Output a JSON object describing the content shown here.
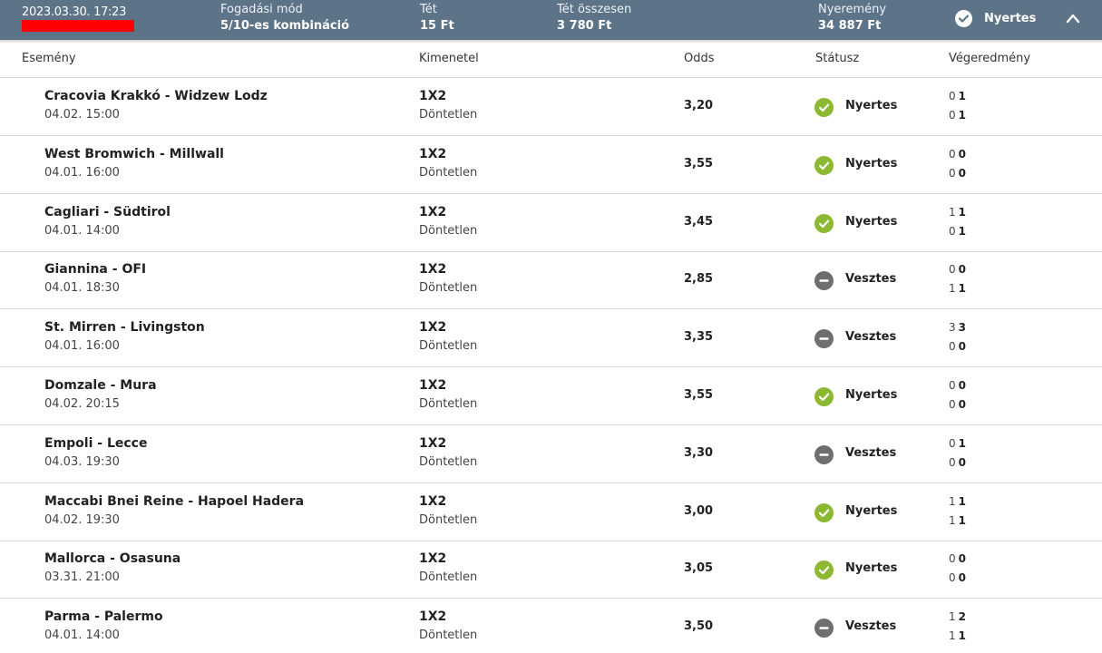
{
  "header": {
    "datetime": "2023.03.30. 17:23",
    "bet_type_label": "Fogadási mód",
    "bet_type_value": "5/10-es kombináció",
    "stake_label": "Tét",
    "stake_value": "15 Ft",
    "total_stake_label": "Tét összesen",
    "total_stake_value": "3 780 Ft",
    "winnings_label": "Nyeremény",
    "winnings_value": "34 887 Ft",
    "status": "Nyertes"
  },
  "columns": {
    "event": "Esemény",
    "outcome": "Kimenetel",
    "odds": "Odds",
    "status": "Státusz",
    "result": "Végeredmény"
  },
  "rows": [
    {
      "event": "Cracovia Krakkó - Widzew Lodz",
      "date": "04.02. 15:00",
      "market": "1X2",
      "outcome": "Döntetlen",
      "odds": "3,20",
      "status": "Nyertes",
      "win": true,
      "ht_home": "0",
      "ft_home": "1",
      "ht_away": "0",
      "ft_away": "1"
    },
    {
      "event": "West Bromwich - Millwall",
      "date": "04.01. 16:00",
      "market": "1X2",
      "outcome": "Döntetlen",
      "odds": "3,55",
      "status": "Nyertes",
      "win": true,
      "ht_home": "0",
      "ft_home": "0",
      "ht_away": "0",
      "ft_away": "0"
    },
    {
      "event": "Cagliari - Südtirol",
      "date": "04.01. 14:00",
      "market": "1X2",
      "outcome": "Döntetlen",
      "odds": "3,45",
      "status": "Nyertes",
      "win": true,
      "ht_home": "1",
      "ft_home": "1",
      "ht_away": "0",
      "ft_away": "1"
    },
    {
      "event": "Giannina - OFI",
      "date": "04.01. 18:30",
      "market": "1X2",
      "outcome": "Döntetlen",
      "odds": "2,85",
      "status": "Vesztes",
      "win": false,
      "ht_home": "0",
      "ft_home": "0",
      "ht_away": "1",
      "ft_away": "1"
    },
    {
      "event": "St. Mirren - Livingston",
      "date": "04.01. 16:00",
      "market": "1X2",
      "outcome": "Döntetlen",
      "odds": "3,35",
      "status": "Vesztes",
      "win": false,
      "ht_home": "3",
      "ft_home": "3",
      "ht_away": "0",
      "ft_away": "0"
    },
    {
      "event": "Domzale - Mura",
      "date": "04.02. 20:15",
      "market": "1X2",
      "outcome": "Döntetlen",
      "odds": "3,55",
      "status": "Nyertes",
      "win": true,
      "ht_home": "0",
      "ft_home": "0",
      "ht_away": "0",
      "ft_away": "0"
    },
    {
      "event": "Empoli - Lecce",
      "date": "04.03. 19:30",
      "market": "1X2",
      "outcome": "Döntetlen",
      "odds": "3,30",
      "status": "Vesztes",
      "win": false,
      "ht_home": "0",
      "ft_home": "1",
      "ht_away": "0",
      "ft_away": "0"
    },
    {
      "event": "Maccabi Bnei Reine - Hapoel Hadera",
      "date": "04.02. 19:30",
      "market": "1X2",
      "outcome": "Döntetlen",
      "odds": "3,00",
      "status": "Nyertes",
      "win": true,
      "ht_home": "1",
      "ft_home": "1",
      "ht_away": "1",
      "ft_away": "1"
    },
    {
      "event": "Mallorca - Osasuna",
      "date": "03.31. 21:00",
      "market": "1X2",
      "outcome": "Döntetlen",
      "odds": "3,05",
      "status": "Nyertes",
      "win": true,
      "ht_home": "0",
      "ft_home": "0",
      "ht_away": "0",
      "ft_away": "0"
    },
    {
      "event": "Parma - Palermo",
      "date": "04.01. 14:00",
      "market": "1X2",
      "outcome": "Döntetlen",
      "odds": "3,50",
      "status": "Vesztes",
      "win": false,
      "ht_home": "1",
      "ft_home": "2",
      "ht_away": "1",
      "ft_away": "1"
    }
  ],
  "colors": {
    "header_bg": "#5d7388",
    "win": "#8cb832",
    "lose": "#6f6f6f",
    "redaction": "#ff0000"
  },
  "icons": {
    "win": "check-circle-icon",
    "lose": "minus-circle-icon",
    "collapse": "chevron-up-icon"
  }
}
